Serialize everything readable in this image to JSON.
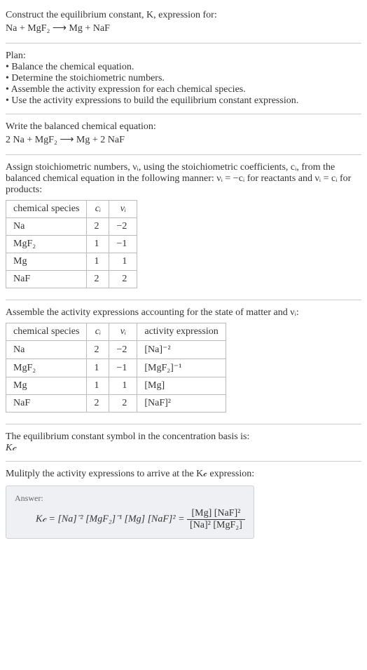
{
  "header": {
    "title": "Construct the equilibrium constant, K, expression for:",
    "equation": "Na + MgF₂ ⟶ Mg + NaF"
  },
  "plan": {
    "title": "Plan:",
    "items": [
      "• Balance the chemical equation.",
      "• Determine the stoichiometric numbers.",
      "• Assemble the activity expression for each chemical species.",
      "• Use the activity expressions to build the equilibrium constant expression."
    ]
  },
  "balanced": {
    "title": "Write the balanced chemical equation:",
    "equation": "2 Na + MgF₂ ⟶ Mg + 2 NaF"
  },
  "stoich": {
    "intro_1": "Assign stoichiometric numbers, νᵢ, using the stoichiometric coefficients, cᵢ, from the balanced chemical equation in the following manner: νᵢ = −cᵢ for reactants and νᵢ = cᵢ for products:",
    "headers": {
      "species": "chemical species",
      "ci": "cᵢ",
      "vi": "νᵢ"
    },
    "rows": [
      {
        "species": "Na",
        "ci": "2",
        "vi": "−2"
      },
      {
        "species": "MgF₂",
        "ci": "1",
        "vi": "−1"
      },
      {
        "species": "Mg",
        "ci": "1",
        "vi": "1"
      },
      {
        "species": "NaF",
        "ci": "2",
        "vi": "2"
      }
    ]
  },
  "activity": {
    "intro": "Assemble the activity expressions accounting for the state of matter and νᵢ:",
    "headers": {
      "species": "chemical species",
      "ci": "cᵢ",
      "vi": "νᵢ",
      "activity": "activity expression"
    },
    "rows": [
      {
        "species": "Na",
        "ci": "2",
        "vi": "−2",
        "expr": "[Na]⁻²"
      },
      {
        "species": "MgF₂",
        "ci": "1",
        "vi": "−1",
        "expr": "[MgF₂]⁻¹"
      },
      {
        "species": "Mg",
        "ci": "1",
        "vi": "1",
        "expr": "[Mg]"
      },
      {
        "species": "NaF",
        "ci": "2",
        "vi": "2",
        "expr": "[NaF]²"
      }
    ]
  },
  "kc_symbol": {
    "intro": "The equilibrium constant symbol in the concentration basis is:",
    "symbol": "K𝒸"
  },
  "multiply": {
    "intro": "Mulitply the activity expressions to arrive at the K𝒸 expression:"
  },
  "answer": {
    "label": "Answer:",
    "lhs": "K𝒸 = [Na]⁻² [MgF₂]⁻¹ [Mg] [NaF]² = ",
    "frac_num": "[Mg] [NaF]²",
    "frac_den": "[Na]² [MgF₂]"
  },
  "chart_data": {
    "type": "table",
    "tables": [
      {
        "title": "Stoichiometric numbers",
        "columns": [
          "chemical species",
          "cᵢ",
          "νᵢ"
        ],
        "rows": [
          [
            "Na",
            2,
            -2
          ],
          [
            "MgF₂",
            1,
            -1
          ],
          [
            "Mg",
            1,
            1
          ],
          [
            "NaF",
            2,
            2
          ]
        ]
      },
      {
        "title": "Activity expressions",
        "columns": [
          "chemical species",
          "cᵢ",
          "νᵢ",
          "activity expression"
        ],
        "rows": [
          [
            "Na",
            2,
            -2,
            "[Na]^-2"
          ],
          [
            "MgF₂",
            1,
            -1,
            "[MgF₂]^-1"
          ],
          [
            "Mg",
            1,
            1,
            "[Mg]"
          ],
          [
            "NaF",
            2,
            2,
            "[NaF]^2"
          ]
        ]
      }
    ]
  }
}
